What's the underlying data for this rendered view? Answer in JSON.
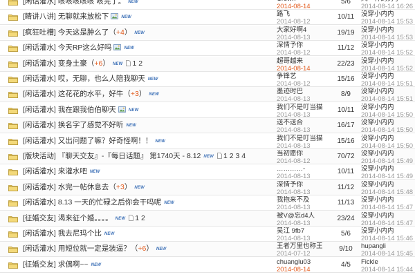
{
  "rows": [
    {
      "cat": "[闲话灌水]",
      "topic": "咳咳咳咳咳 咳完了。",
      "new": "NEW",
      "author": "Crown",
      "adate": "2014-08-14",
      "stats": "5/6",
      "lname": "风一样的男子",
      "ldate": "2014-08-14 16:26"
    },
    {
      "cat": "[睛讲八讲]",
      "topic": "无聊就来放松下",
      "new": "NEW",
      "author": "路飞",
      "adate": "2014-08-12",
      "stats": "10/11",
      "lname": "没穿小内内",
      "ldate": "2014-08-14 15:53"
    },
    {
      "cat": "[疯狂吐槽]",
      "topic": "今天这是肿么了",
      "plus": "+4",
      "new": "NEW",
      "author": "大家好啊4",
      "adate": "2014-08-13",
      "stats": "19/19",
      "lname": "没穿小内内",
      "ldate": "2014-08-14 15:53"
    },
    {
      "cat": "[闲话灌水]",
      "topic": "今天RP这么好吗",
      "new": "NEW",
      "author": "深情予你",
      "adate": "2014-08-12",
      "stats": "11/12",
      "lname": "没穿小内内",
      "ldate": "2014-08-14 15:52"
    },
    {
      "cat": "[闲话灌水]",
      "topic": "变身土豪",
      "plus": "+6",
      "new": "NEW",
      "pages": "1 2",
      "author": "超哥越来",
      "adate": "2014-08-14",
      "stats": "22/23",
      "lname": "没穿小内内",
      "ldate": "2014-08-14 15:52"
    },
    {
      "cat": "[闲话灌水]",
      "topic": "哎，无聊，也么人陪我聊天",
      "new": "NEW",
      "author": "争锋艺",
      "adate": "2014-08-12",
      "stats": "15/16",
      "lname": "没穿小内内",
      "ldate": "2014-08-14 15:51"
    },
    {
      "cat": "[闲话灌水]",
      "topic": "这花花的水平，好牛",
      "plus": "+3",
      "new": "NEW",
      "author": "墨迹时巴",
      "adate": "2014-08-13",
      "stats": "8/9",
      "lname": "没穿小内内",
      "ldate": "2014-08-14 15:51"
    },
    {
      "cat": "[闲话灌水]",
      "topic": "我在跟我伯伯聊天",
      "new": "NEW",
      "author": "我们不是叮当猫",
      "adate": "2014-08-13",
      "stats": "10/11",
      "lname": "没穿小内内",
      "ldate": "2014-08-14 15:50"
    },
    {
      "cat": "[闲话灌水]",
      "topic": "换名字了感觉不好听",
      "new": "NEW",
      "author": "送不送合",
      "adate": "2014-08-13",
      "stats": "16/17",
      "lname": "没穿小内内",
      "ldate": "2014-08-14 15:50"
    },
    {
      "cat": "[闲话灌水]",
      "topic": "又出问题了嘛？好奇怪啊！！",
      "new": "NEW",
      "author": "我们不是叮当猫",
      "adate": "2014-08-13",
      "stats": "15/16",
      "lname": "没穿小内内",
      "ldate": "2014-08-14 15:50"
    },
    {
      "cat": "[版块活动]",
      "topic": "『聊天交友』-『每日话题』 第1740天 - 8.12",
      "new": "NEW",
      "pages": "1 2 3 4",
      "author": "当初愿你",
      "adate": "2014-08-12",
      "stats": "70/72",
      "lname": "没穿小内内",
      "ldate": "2014-08-14 15:49"
    },
    {
      "cat": "[闲话灌水]",
      "topic": "来灌水吧",
      "new": "NEW",
      "author": "…………-",
      "adate": "2014-08-13",
      "stats": "10/11",
      "lname": "没穿小内内",
      "ldate": "2014-08-14 15:49"
    },
    {
      "cat": "[闲话灌水]",
      "topic": "水完一帖休息去",
      "plus": "+3",
      "new": "NEW",
      "author": "深情予你",
      "adate": "2014-08-13",
      "stats": "11/12",
      "lname": "没穿小内内",
      "ldate": "2014-08-14 15:48"
    },
    {
      "cat": "[闲话灌水]",
      "topic": "8.13 一天的忙碌之后你会干吗呢",
      "new": "NEW",
      "author": "我抱来不及",
      "adate": "2014-08-13",
      "stats": "11/13",
      "lname": "没穿小内内",
      "ldate": "2014-08-14 15:47"
    },
    {
      "cat": "[征婚交友]",
      "topic": "渴来征个婚。。。。",
      "new": "NEW",
      "pages": "1 2",
      "author": "被V@忘d4人",
      "adate": "2014-08-13",
      "stats": "23/24",
      "lname": "没穿小内内",
      "ldate": "2014-08-14 15:47"
    },
    {
      "cat": "[闲话灌水]",
      "topic": "我去尼玛个比",
      "new": "NEW",
      "author": "吴江 9fb7",
      "adate": "2014-08-13",
      "stats": "5/6",
      "lname": "没穿小内内",
      "ldate": "2014-08-14 15:46"
    },
    {
      "cat": "[闲话灌水]",
      "topic": "用短位就一定是装逼？",
      "plus": "+6",
      "new": "NEW",
      "author": "王者万里也称王",
      "adate": "2014-07-12",
      "stats": "9/10",
      "lname": "hupangli",
      "ldate": "2014-08-14 15:45"
    },
    {
      "cat": "[征婚交友]",
      "topic": "求偶啊~~",
      "new": "NEW",
      "author": "chuanglu03",
      "adate": "2014-08-14",
      "stats": "4/5",
      "lname": "Fickle",
      "ldate": "2014-08-14 15:44"
    }
  ],
  "colors": {
    "accent": "#e25a1c",
    "link": "#3b6fb6",
    "muted": "#999999"
  },
  "icons": {
    "row_icon": "folder-icon",
    "image_attachment": "image-icon",
    "multi_page": "page-icon"
  }
}
